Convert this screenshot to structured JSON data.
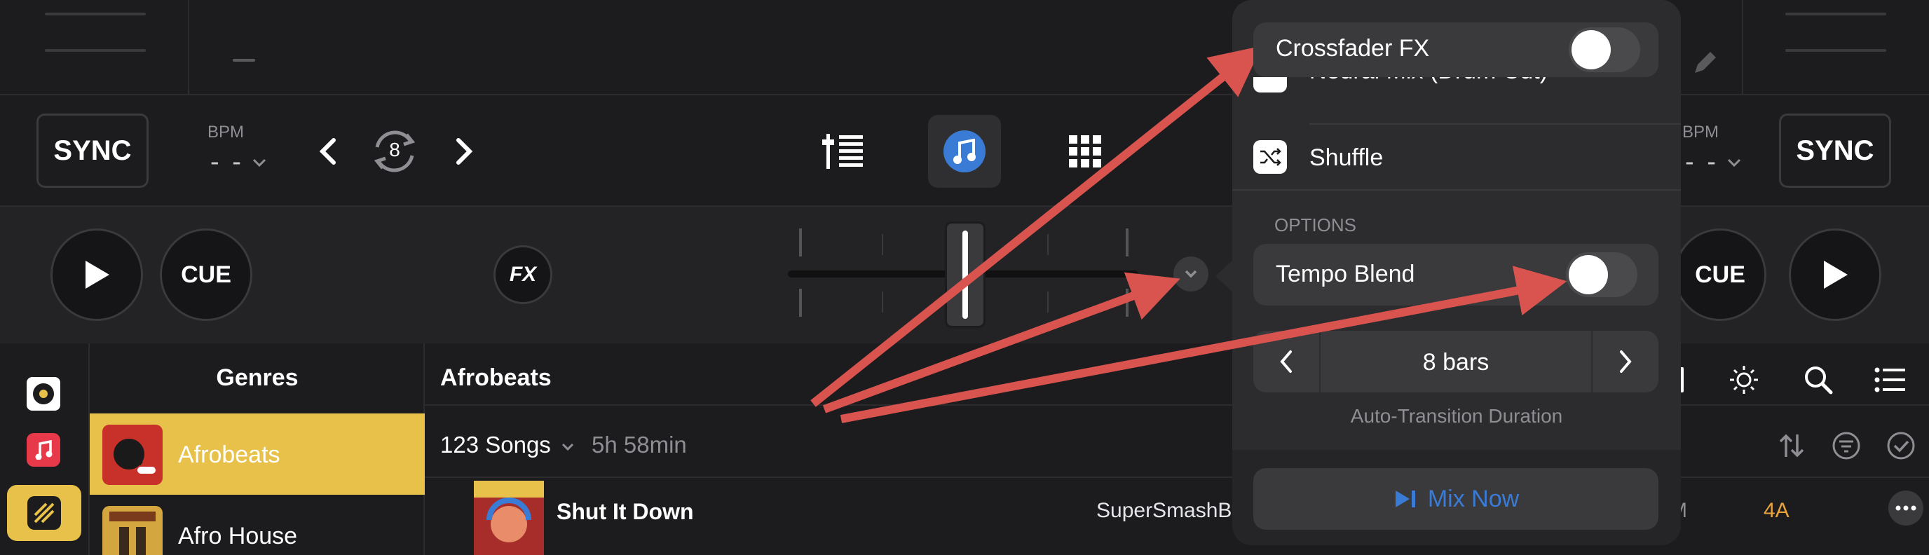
{
  "deck_left": {
    "sync_label": "SYNC",
    "bpm_label": "BPM",
    "bpm_value": "- -",
    "loop_size": "8",
    "cue_label": "CUE",
    "fx_label": "FX"
  },
  "deck_right": {
    "sync_label": "SYNC",
    "bpm_label": "BPM",
    "bpm_value": "- -",
    "cue_label": "CUE"
  },
  "library": {
    "genres_title": "Genres",
    "genres": [
      "Afrobeats",
      "Afro House"
    ],
    "selected_genre": "Afrobeats",
    "list_title": "Afrobeats",
    "song_count": "123 Songs",
    "duration": "5h 58min",
    "tracks": [
      {
        "title": "Shut It Down",
        "artist": "SuperSmashB",
        "extra": "M",
        "key": "4A"
      }
    ]
  },
  "popover": {
    "crossfader_fx_label": "Crossfader FX",
    "crossfader_fx_on": false,
    "neural_mix_label": "Neural Mix (Drum Cut)",
    "shuffle_label": "Shuffle",
    "options_header": "OPTIONS",
    "tempo_blend_label": "Tempo Blend",
    "tempo_blend_on": false,
    "duration_value": "8 bars",
    "duration_caption": "Auto-Transition Duration",
    "mix_now_label": "Mix Now"
  },
  "colors": {
    "accent_blue": "#3a7bd5",
    "selected_genre_bg": "#e8c14a",
    "key_orange": "#e8a33a",
    "annotation_arrow": "#d9534f"
  }
}
